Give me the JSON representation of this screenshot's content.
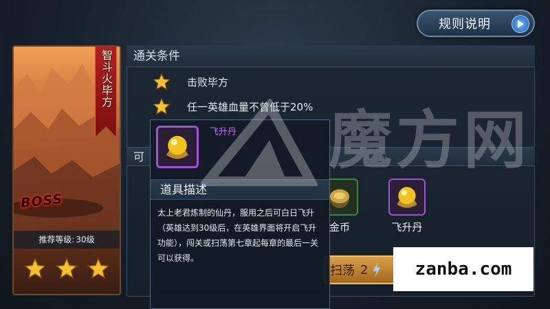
{
  "header": {
    "rules_button": {
      "label": "规则说明"
    }
  },
  "boss": {
    "name": "智斗火毕方",
    "badge": "BOSS",
    "recommended_level": {
      "label": "推荐等级:",
      "value": "30级"
    },
    "stars_earned": 3,
    "stars_total": 3
  },
  "conditions": {
    "title": "通关条件",
    "items": [
      {
        "text": "击败毕方"
      },
      {
        "text": "任一英雄血量不曾低于20%"
      }
    ]
  },
  "rewards": {
    "title_partial": "可",
    "items": [
      {
        "name": "金币",
        "icon": "gold-coin-icon"
      },
      {
        "name": "飞升丹",
        "icon": "ascension-pill-icon"
      }
    ]
  },
  "sweep": {
    "label": "扫荡",
    "count": "2"
  },
  "tooltip": {
    "item_name": "飞升丹",
    "section_title": "道具描述",
    "description": "太上老君炼制的仙丹，服用之后可白日飞升（英雄达到30级后，在英雄界面将开启飞升功能），闯关或扫荡第七章起每章的最后一关可以获得。"
  },
  "watermark": {
    "text": "魔方网"
  },
  "site_badge": {
    "text": "zanba.com"
  },
  "colors": {
    "accent_purple": "#c26bff",
    "star_gold": "#f5c030",
    "banner_red": "#b32020",
    "button_gold": "#d9a04a"
  }
}
